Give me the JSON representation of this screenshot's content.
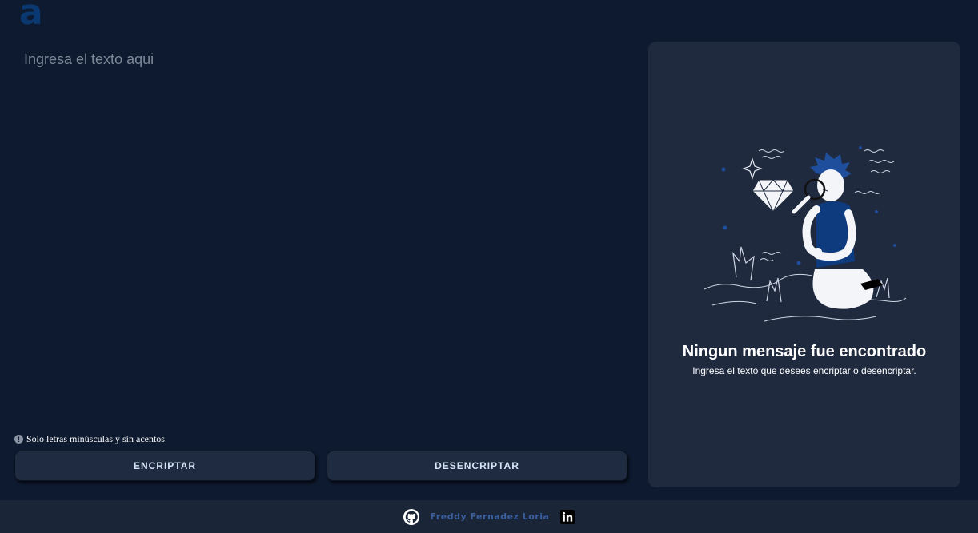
{
  "logo": {
    "glyph": "a",
    "color": "#0a3871"
  },
  "input": {
    "placeholder": "Ingresa el texto aqui"
  },
  "hint": {
    "icon": "info-icon",
    "text": "Solo letras minúsculas y sin acentos"
  },
  "buttons": {
    "encrypt": "ENCRIPTAR",
    "decrypt": "DESENCRIPTAR"
  },
  "output_panel": {
    "illustration": "person-magnifying-glass-diamond",
    "title": "Ningun mensaje fue encontrado",
    "subtitle": "Ingresa el texto que desees encriptar o desencriptar."
  },
  "footer": {
    "github_icon": "github-icon",
    "author": "Freddy Fernadez Loria",
    "linkedin_icon": "linkedin-icon"
  },
  "colors": {
    "background": "#0e1a2f",
    "panel": "#1f2a3f",
    "footer": "#1b2538",
    "accent": "#0a3871"
  }
}
